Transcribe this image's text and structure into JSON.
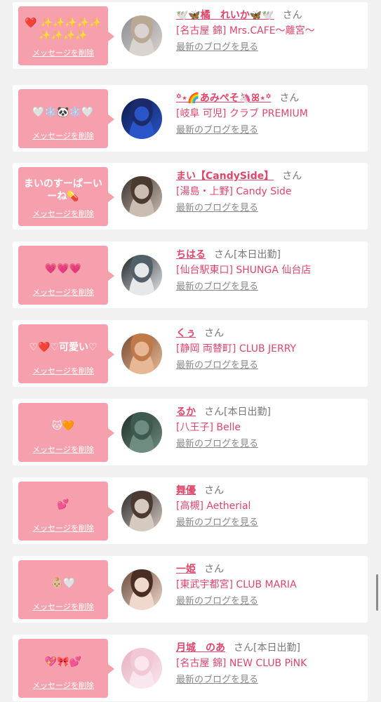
{
  "delete_label": "メッセージを削除",
  "blog_label": "最新のブログを見る",
  "san_label": "さん",
  "cards": [
    {
      "message": "❤️ ✨✨✨✨✨ ✨✨✨✨",
      "name": "🕊️🦋橘　れいか🦋🕊️",
      "status": "",
      "shop": "[名古屋 錦] Mrs.CAFE〜離宮〜",
      "avatar": {
        "c1": "#8c8c92",
        "c2": "#d9d4cf",
        "hair": "#b9a894"
      }
    },
    {
      "message": "🤍❄️🐼❄️🤍",
      "name": "꙳⋆🌈あみぺそ🦄ꕤ⋆꙳",
      "status": "",
      "shop": "[岐阜 可児] クラブ PREMIUM",
      "avatar": {
        "c1": "#0b1a4a",
        "c2": "#2a55c8",
        "hair": "#1a2a6a"
      }
    },
    {
      "message": "まいのすーぱーいーね💊",
      "name": "まい【CandySide】",
      "status": "",
      "shop": "[湯島・上野] Candy Side",
      "avatar": {
        "c1": "#3a302c",
        "c2": "#cbbdb2",
        "hair": "#4a3a30"
      }
    },
    {
      "message": "💗💗💗",
      "name": "ちはる",
      "status": "[本日出勤]",
      "shop": "[仙台駅東口] SHUNGA 仙台店",
      "avatar": {
        "c1": "#1d2328",
        "c2": "#e6e8ea",
        "hair": "#52606a"
      }
    },
    {
      "message": "♡❤️♡可愛い♡",
      "name": "くぅ",
      "status": "",
      "shop": "[静岡 両替町] CLUB JERRY",
      "avatar": {
        "c1": "#7a4a30",
        "c2": "#e8b896",
        "hair": "#c07a4a"
      }
    },
    {
      "message": "🐱🧡",
      "name": "るか",
      "status": "[本日出勤]",
      "shop": "[八王子] Belle",
      "avatar": {
        "c1": "#1e2e28",
        "c2": "#6f8c80",
        "hair": "#3e5a50"
      }
    },
    {
      "message": "💕",
      "name": "舞優",
      "status": "",
      "shop": "[高槻] Aetherial",
      "avatar": {
        "c1": "#2a2a2a",
        "c2": "#d6c9c0",
        "hair": "#4a3a32"
      }
    },
    {
      "message": "👶🏼🤍",
      "name": "一姫",
      "status": "",
      "shop": "[東武宇都宮] CLUB MARIA",
      "avatar": {
        "c1": "#6a4a3a",
        "c2": "#f0d8cc",
        "hair": "#4a2e24"
      }
    },
    {
      "message": "💖🎀💕",
      "name": "月城　のあ",
      "status": "[本日出勤]",
      "shop": "[名古屋 錦] NEW CLUB PiNK",
      "avatar": {
        "c1": "#e8b0c0",
        "c2": "#fae6ee",
        "hair": "#f2c8d6"
      }
    }
  ]
}
